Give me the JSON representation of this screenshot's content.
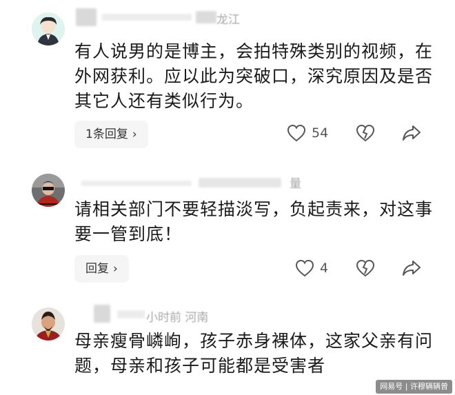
{
  "comments": [
    {
      "meta_visible": "龙江",
      "text": "有人说男的是博主，会拍特殊类别的视频，在外网获利。应以此为突破口，深究原因及是否其它人还有类似行为。",
      "reply_label": "1条回复",
      "like_count": "54"
    },
    {
      "meta_visible": "量",
      "text": "请相关部门不要轻描淡写，负起责来，对这事要一管到底！",
      "reply_label": "回复",
      "like_count": "4"
    },
    {
      "meta_visible": "小时前 河南",
      "text": "母亲瘦骨嶙峋，孩子赤身裸体，这家父亲有问题，母亲和孩子可能都是受害者",
      "reply_label": "",
      "like_count": ""
    }
  ],
  "icons": {
    "like": "heart-outline-icon",
    "dislike": "broken-heart-icon",
    "share": "share-arrow-icon",
    "chevron": "chevron-right-icon"
  },
  "watermark": "网易号 | 许穆辆辆曾"
}
